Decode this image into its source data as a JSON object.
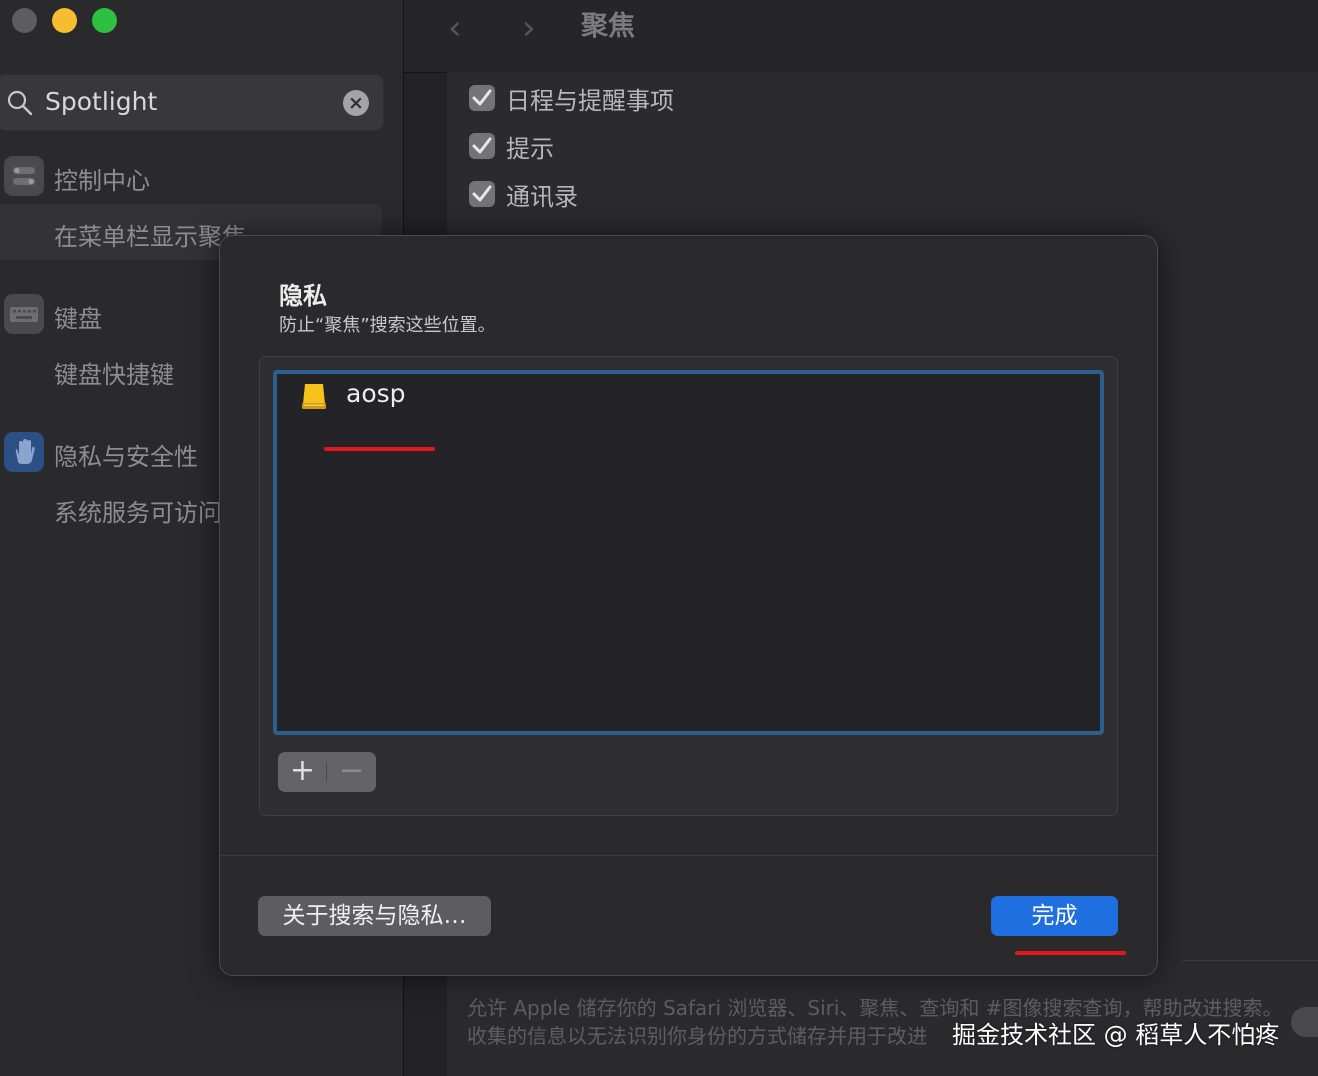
{
  "sidebar": {
    "search_value": "Spotlight",
    "items": [
      {
        "label": "控制中心",
        "icon": "control-center-icon"
      },
      {
        "label": "在菜单栏显示聚焦"
      },
      {
        "label": "键盘",
        "icon": "keyboard-icon"
      },
      {
        "label": "键盘快捷键"
      },
      {
        "label": "隐私与安全性",
        "icon": "hand-icon"
      },
      {
        "label": "系统服务可访问"
      }
    ]
  },
  "main": {
    "title": "聚焦",
    "checkboxes": [
      {
        "label": "日程与提醒事项",
        "checked": true
      },
      {
        "label": "提示",
        "checked": true
      },
      {
        "label": "通讯录",
        "checked": true
      }
    ],
    "description": [
      "允许 Apple 储存你的 Safari 浏览器、Siri、聚焦、查询和 #图像搜索查询，帮助改进搜索。",
      "收集的信息以无法识别你身份的方式储存并用于改进"
    ]
  },
  "dialog": {
    "title": "隐私",
    "subtitle": "防止“聚焦”搜索这些位置。",
    "items": [
      {
        "label": "aosp",
        "icon": "drive-icon"
      }
    ],
    "about_button": "关于搜索与隐私…",
    "done_button": "完成"
  },
  "watermark": "掘金技术社区 @ 稻草人不怕疼",
  "colors": {
    "accent": "#1f6fe0",
    "annotation_red": "#e4161e",
    "selection_border": "#2c5e90"
  }
}
